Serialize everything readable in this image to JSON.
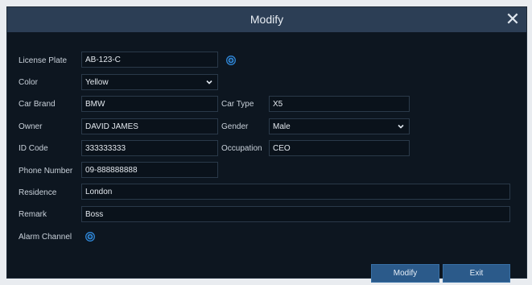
{
  "dialog": {
    "title": "Modify",
    "close_glyph": "✕"
  },
  "form": {
    "license_plate": {
      "label": "License Plate",
      "value": "AB-123-C"
    },
    "color": {
      "label": "Color",
      "value": "Yellow"
    },
    "car_brand": {
      "label": "Car Brand",
      "value": "BMW"
    },
    "car_type": {
      "label": "Car Type",
      "value": "X5"
    },
    "owner": {
      "label": "Owner",
      "value": "DAVID JAMES"
    },
    "gender": {
      "label": "Gender",
      "value": "Male"
    },
    "id_code": {
      "label": "ID Code",
      "value": "333333333"
    },
    "occupation": {
      "label": "Occupation",
      "value": "CEO"
    },
    "phone_number": {
      "label": "Phone Number",
      "value": "09-888888888"
    },
    "residence": {
      "label": "Residence",
      "value": "London"
    },
    "remark": {
      "label": "Remark",
      "value": "Boss"
    },
    "alarm_channel": {
      "label": "Alarm Channel"
    }
  },
  "buttons": {
    "modify": "Modify",
    "exit": "Exit"
  },
  "colors": {
    "accent": "#2b5a8a",
    "add_icon": "#2f86d6",
    "titlebar": "#2c3e55",
    "panel": "#0d1620"
  },
  "icons": {
    "close": "close-icon",
    "add": "plus-circle-icon",
    "dropdown": "chevron-down-icon"
  }
}
